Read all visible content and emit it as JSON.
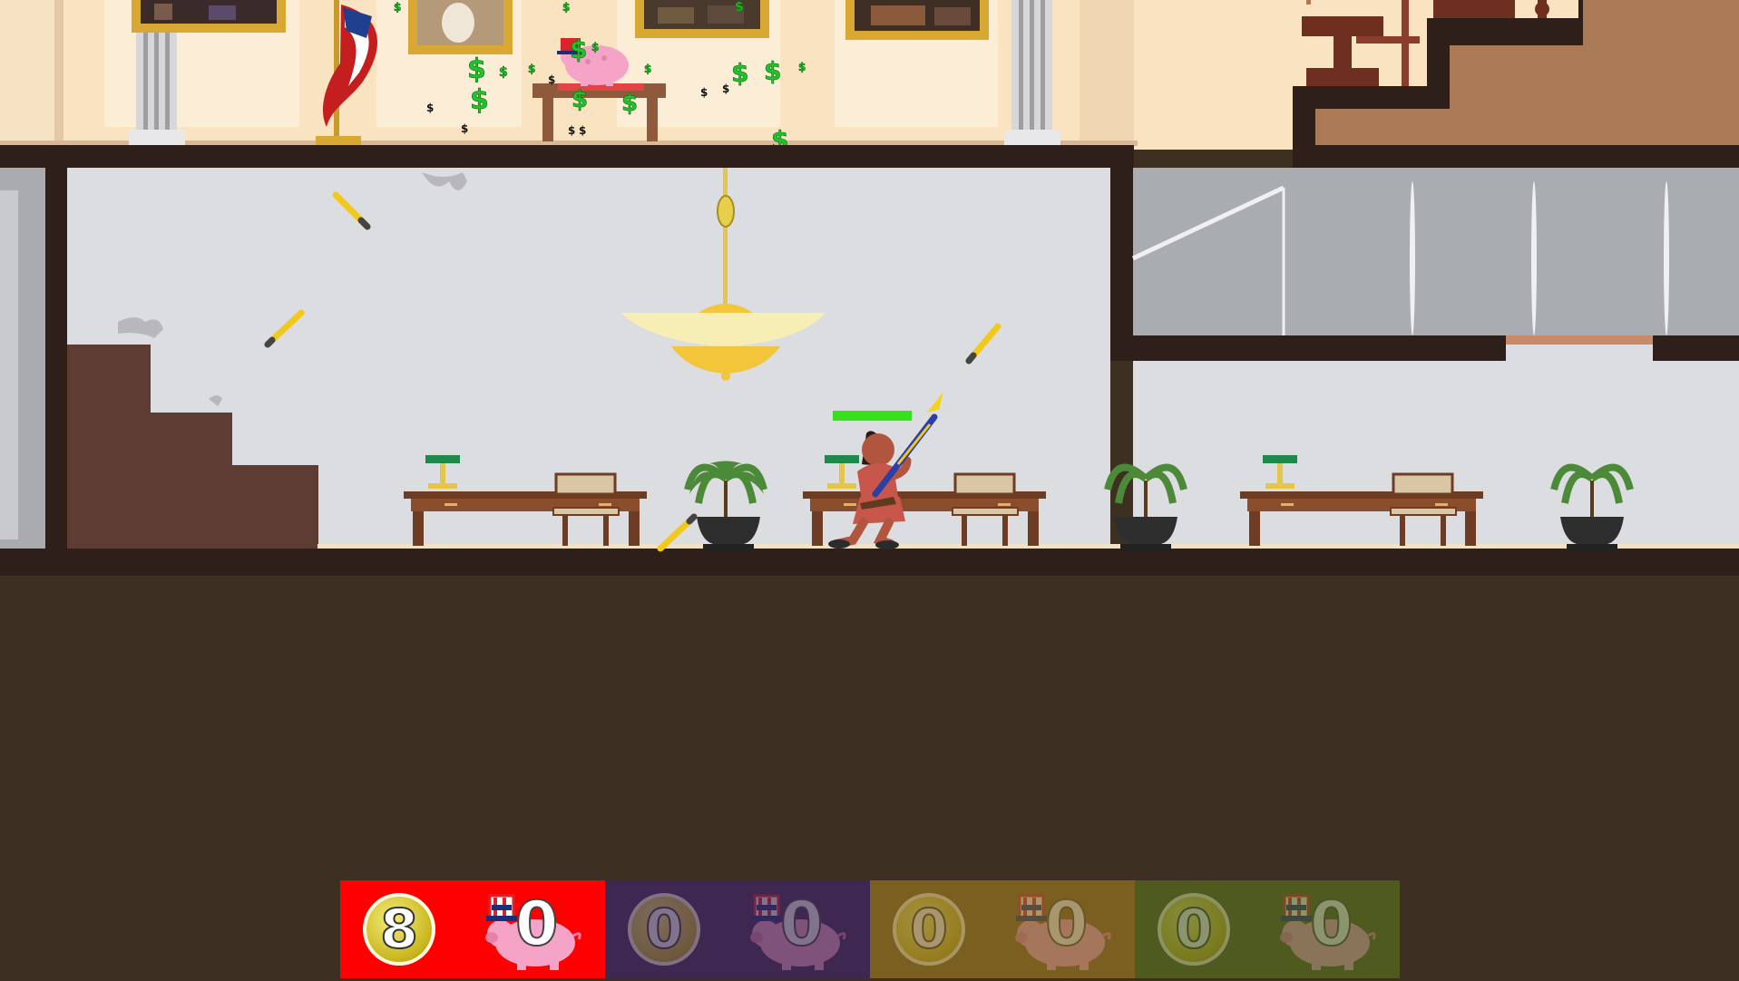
{
  "game": {
    "title": "",
    "scene": "White House interior",
    "colors": {
      "ceiling_wall": "#f9e3c0",
      "floor_line": "#2f1f1a",
      "room_wall": "#dcdde0",
      "ground": "#3d2f21",
      "stairs": "#5d3d33",
      "money": "#22c22b"
    }
  },
  "player": {
    "name_icon": "soldier-with-rifle",
    "health_fraction": 1.0,
    "health_color": "#35e21a"
  },
  "hud": {
    "players": [
      {
        "id": "p1",
        "color": "#ff0000",
        "coins": "8",
        "pigs": "0",
        "active": true
      },
      {
        "id": "p2",
        "color": "#3e2750",
        "coins": "0",
        "pigs": "0",
        "active": false
      },
      {
        "id": "p3",
        "color": "#7a5f20",
        "coins": "0",
        "pigs": "0",
        "active": false
      },
      {
        "id": "p4",
        "color": "#4e5a1e",
        "coins": "0",
        "pigs": "0",
        "active": false
      }
    ]
  },
  "icons": [
    "coin-icon",
    "piggy-bank-icon",
    "dollar-sign-icon",
    "bullet-icon",
    "chandelier-icon",
    "flag-icon",
    "palm-plant-icon",
    "desk-icon",
    "chair-icon",
    "lamp-icon",
    "painting-icon",
    "column-icon"
  ]
}
